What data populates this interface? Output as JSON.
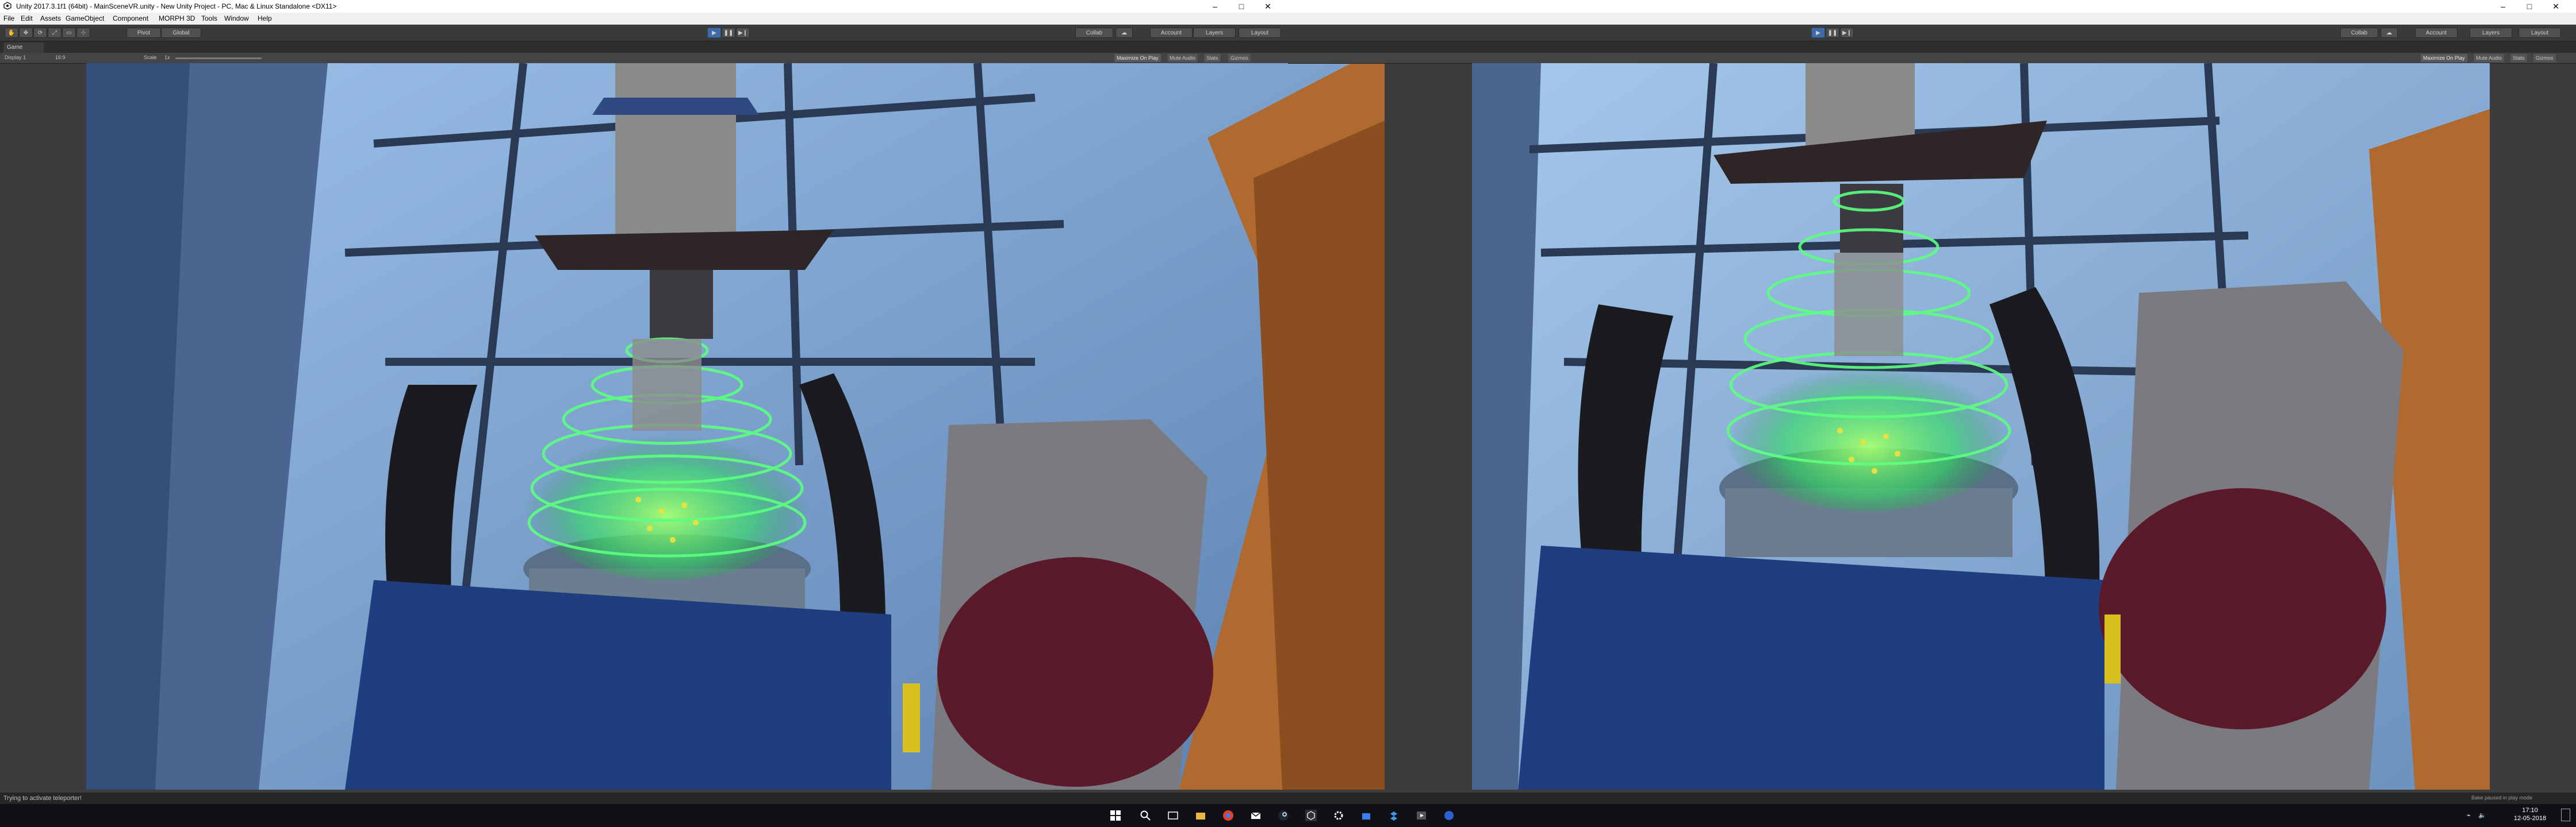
{
  "window": {
    "title": "Unity 2017.3.1f1 (64bit) - MainSceneVR.unity - New Unity Project - PC, Mac & Linux Standalone <DX11>",
    "minimize": "–",
    "maximize": "□",
    "close": "✕"
  },
  "menu": [
    "File",
    "Edit",
    "Assets",
    "GameObject",
    "Component",
    "MORPH 3D",
    "Tools",
    "Window",
    "Help"
  ],
  "toolbar": {
    "pivot_label": "Pivot",
    "global_label": "Global",
    "collab_label": "Collab",
    "account_label": "Account",
    "layers_label": "Layers",
    "layout_label": "Layout"
  },
  "game": {
    "tab_label": "Game",
    "display_label": "Display 1",
    "aspect_label": "16:9",
    "scale_label": "Scale",
    "scale_value": "1x",
    "maximize_label": "Maximize On Play",
    "mute_label": "Mute Audio",
    "stats_label": "Stats",
    "gizmos_label": "Gizmos"
  },
  "status": {
    "message": "Trying to activate teleporter!",
    "bake_note": "Bake paused in play mode"
  },
  "clock": {
    "time": "17:10",
    "date": "12-05-2018"
  },
  "icons": {
    "window_controls": [
      "minimize-icon",
      "maximize-icon",
      "close-icon"
    ],
    "tools": [
      "hand-tool-icon",
      "move-tool-icon",
      "rotate-tool-icon",
      "scale-tool-icon",
      "rect-tool-icon",
      "transform-tool-icon"
    ],
    "play": [
      "play-icon",
      "pause-icon",
      "step-icon"
    ],
    "taskbar": [
      "start-icon",
      "search-icon",
      "task-view-icon",
      "chrome-icon",
      "mail-icon",
      "explorer-icon",
      "steam-icon",
      "unity-icon",
      "settings-icon",
      "store-icon",
      "dropbox-icon"
    ]
  },
  "colors": {
    "title_bg": "#ffffff",
    "menu_bg": "#f0f0f0",
    "editor_bg": "#3c3c3c",
    "play_active": "#3e6aa8",
    "taskbar_bg": "#101016",
    "hologram_green": "#4dff70",
    "crystal_yellow": "#e8e040"
  }
}
